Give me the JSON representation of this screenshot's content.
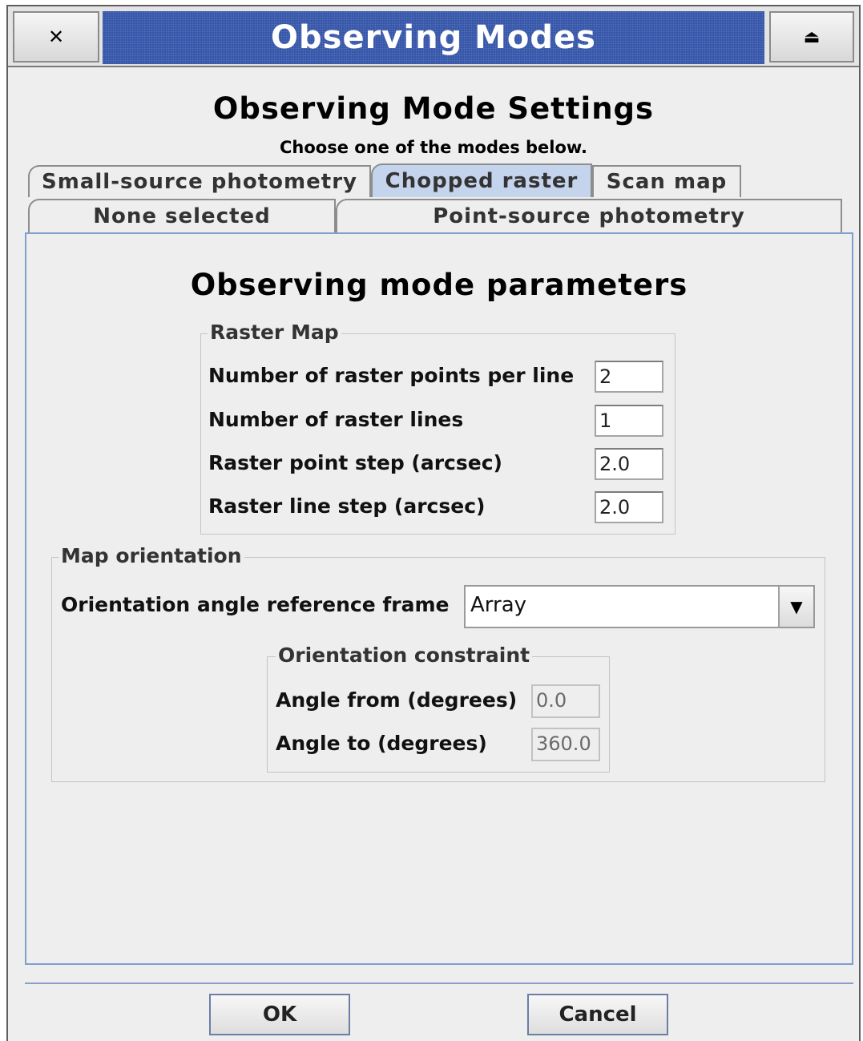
{
  "window": {
    "title": "Observing Modes",
    "close_glyph": "✕",
    "maximize_glyph": "⏏"
  },
  "header": {
    "title": "Observing Mode Settings",
    "subtitle": "Choose one of the modes below."
  },
  "tabs": {
    "row1": [
      "Small-source photometry",
      "Chopped raster",
      "Scan map"
    ],
    "row2": [
      "None selected",
      "Point-source photometry"
    ],
    "active": "Chopped raster"
  },
  "panel": {
    "title": "Observing mode parameters",
    "raster_map": {
      "legend": "Raster Map",
      "fields": [
        {
          "label": "Number of raster points per line",
          "value": "2"
        },
        {
          "label": "Number of raster lines",
          "value": "1"
        },
        {
          "label": "Raster point step (arcsec)",
          "value": "2.0"
        },
        {
          "label": "Raster line step (arcsec)",
          "value": "2.0"
        }
      ]
    },
    "map_orientation": {
      "legend": "Map orientation",
      "frame_label": "Orientation angle reference frame",
      "frame_value": "Array",
      "constraint": {
        "legend": "Orientation constraint",
        "from_label": "Angle from (degrees)",
        "from_value": "0.0",
        "to_label": "Angle to (degrees)",
        "to_value": "360.0"
      }
    }
  },
  "buttons": {
    "ok": "OK",
    "cancel": "Cancel"
  },
  "colors": {
    "title_bar": "#2f50a6",
    "active_tab": "#c4d4ec",
    "panel_border": "#7f9fd0"
  }
}
